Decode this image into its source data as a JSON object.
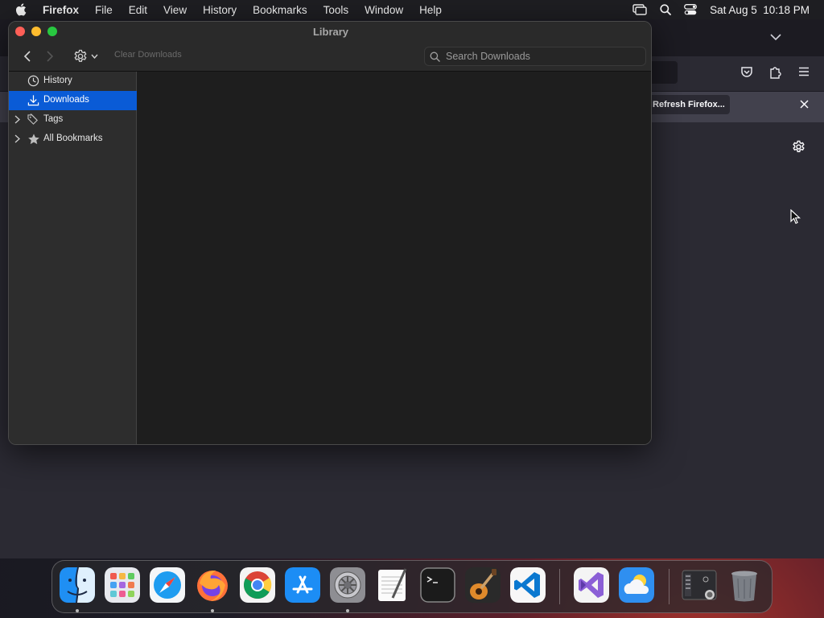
{
  "menubar": {
    "app_name": "Firefox",
    "menus": [
      "File",
      "Edit",
      "View",
      "History",
      "Bookmarks",
      "Tools",
      "Window",
      "Help"
    ],
    "datetime": "Sat Aug 5  10:18 PM"
  },
  "firefox_bg": {
    "refresh_button": "Refresh Firefox..."
  },
  "library": {
    "title": "Library",
    "clear_downloads": "Clear Downloads",
    "search_placeholder": "Search Downloads",
    "sidebar": [
      {
        "label": "History",
        "icon": "clock-icon",
        "selected": false,
        "expandable": false
      },
      {
        "label": "Downloads",
        "icon": "download-icon",
        "selected": true,
        "expandable": false
      },
      {
        "label": "Tags",
        "icon": "tags-icon",
        "selected": false,
        "expandable": true
      },
      {
        "label": "All Bookmarks",
        "icon": "star-icon",
        "selected": false,
        "expandable": true
      }
    ]
  },
  "dock": {
    "apps": [
      "finder",
      "launchpad",
      "safari",
      "firefox",
      "chrome",
      "app-store",
      "system-settings",
      "textedit",
      "terminal",
      "garageband",
      "vscode",
      "visual-studio",
      "weather",
      "preview",
      "trash"
    ]
  },
  "colors": {
    "selection": "#0a5bd6",
    "traffic_red": "#ff5f57",
    "traffic_yellow": "#febc2e",
    "traffic_green": "#28c840"
  }
}
